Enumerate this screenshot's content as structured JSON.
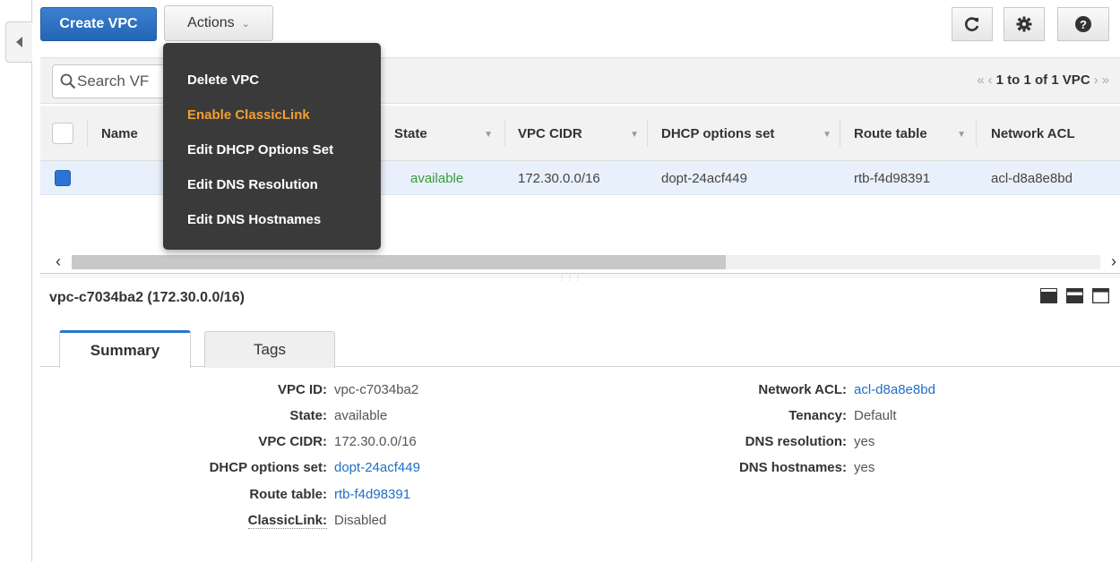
{
  "toolbar": {
    "create_label": "Create VPC",
    "actions_label": "Actions",
    "refresh_icon": "refresh-icon",
    "settings_icon": "gear-icon",
    "help_icon": "help-icon"
  },
  "filter": {
    "search_placeholder": "Search VPCs and their proprt",
    "search_visible": "Search VF",
    "pager_text": "1 to 1 of 1 VPC"
  },
  "actions_menu": {
    "items": [
      {
        "label": "Delete VPC"
      },
      {
        "label": "Enable ClassicLink",
        "highlight": true
      },
      {
        "label": "Edit DHCP Options Set"
      },
      {
        "label": "Edit DNS Resolution"
      },
      {
        "label": "Edit DNS Hostnames"
      }
    ]
  },
  "table": {
    "columns": [
      "Name",
      "State",
      "VPC CIDR",
      "DHCP options set",
      "Route table",
      "Network ACL"
    ],
    "rows": [
      {
        "name": "",
        "state": "available",
        "cidr": "172.30.0.0/16",
        "dhcp": "dopt-24acf449",
        "route_table": "rtb-f4d98391",
        "network_acl": "acl-d8a8e8bd"
      }
    ]
  },
  "detail": {
    "title": "vpc-c7034ba2 (172.30.0.0/16)",
    "tabs": [
      "Summary",
      "Tags"
    ],
    "left": [
      {
        "key": "VPC ID:",
        "value": "vpc-c7034ba2"
      },
      {
        "key": "State:",
        "value": "available"
      },
      {
        "key": "VPC CIDR:",
        "value": "172.30.0.0/16"
      },
      {
        "key": "DHCP options set:",
        "value": "dopt-24acf449"
      },
      {
        "key": "Route table:",
        "value": "rtb-f4d98391"
      },
      {
        "key": "ClassicLink:",
        "value": "Disabled"
      }
    ],
    "right": [
      {
        "key": "Network ACL:",
        "value": "acl-d8a8e8bd"
      },
      {
        "key": "Tenancy:",
        "value": "Default"
      },
      {
        "key": "DNS resolution:",
        "value": "yes"
      },
      {
        "key": "DNS hostnames:",
        "value": "yes"
      }
    ]
  }
}
